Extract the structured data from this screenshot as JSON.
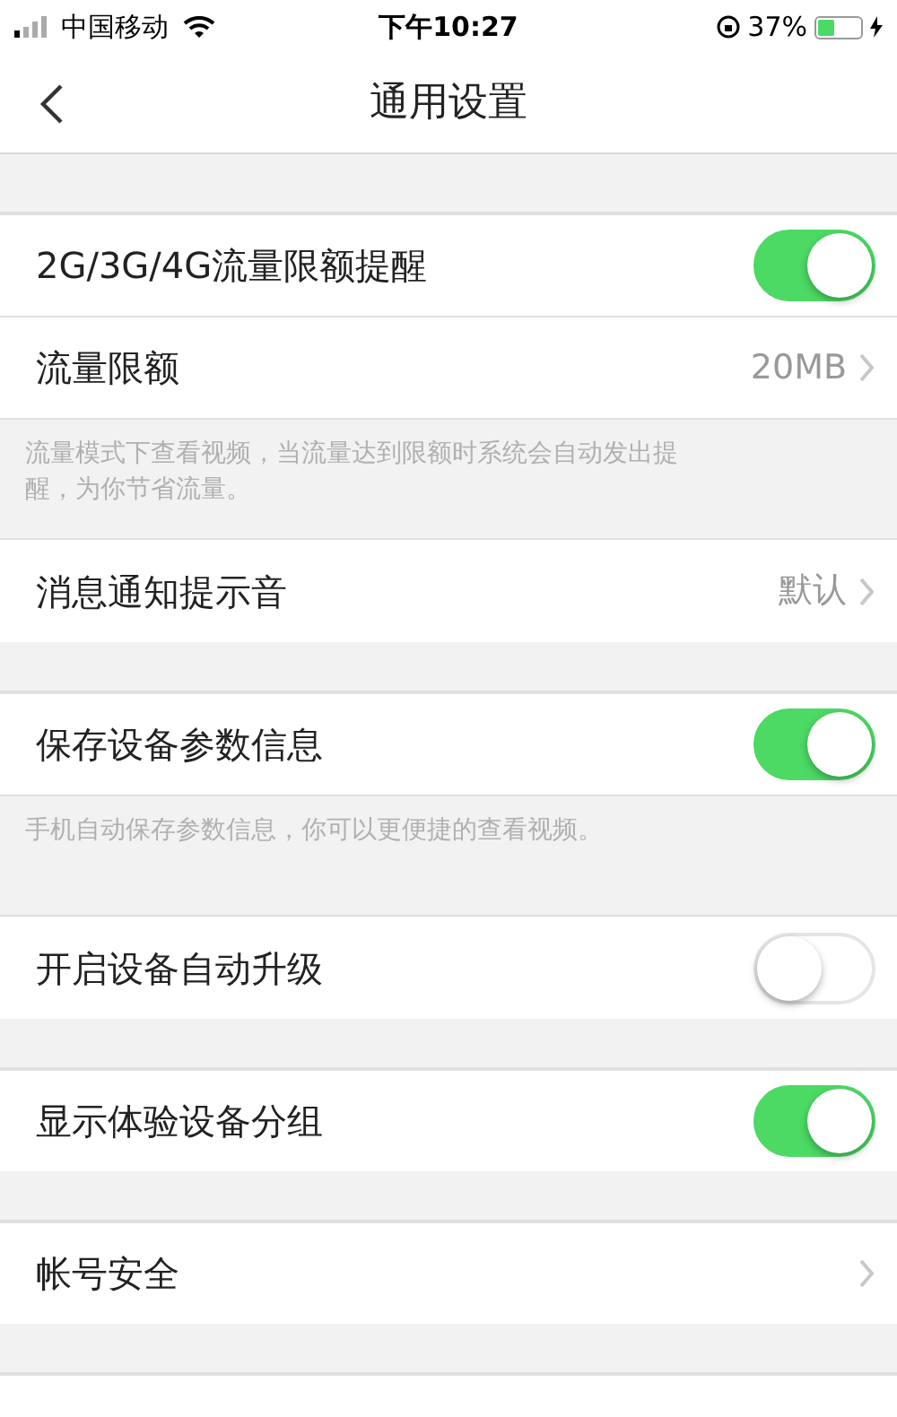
{
  "status_bar": {
    "carrier": "中国移动",
    "time": "下午10:27",
    "battery_percent": "37%",
    "charging": true
  },
  "nav": {
    "title": "通用设置"
  },
  "groups": [
    {
      "items": [
        {
          "kind": "toggle",
          "label": "2G/3G/4G流量限额提醒",
          "on": true
        },
        {
          "kind": "link",
          "label": "流量限额",
          "value": "20MB"
        }
      ],
      "note": "流量模式下查看视频，当流量达到限额时系统会自动发出提醒，为你节省流量。"
    },
    {
      "items": [
        {
          "kind": "link",
          "label": "消息通知提示音",
          "value": "默认"
        }
      ]
    },
    {
      "items": [
        {
          "kind": "toggle",
          "label": "保存设备参数信息",
          "on": true
        }
      ],
      "note": "手机自动保存参数信息，你可以更便捷的查看视频。"
    },
    {
      "items": [
        {
          "kind": "toggle",
          "label": "开启设备自动升级",
          "on": false
        }
      ]
    },
    {
      "items": [
        {
          "kind": "toggle",
          "label": "显示体验设备分组",
          "on": true
        }
      ]
    },
    {
      "items": [
        {
          "kind": "link",
          "label": "帐号安全"
        }
      ]
    },
    {
      "items": [
        {
          "kind": "blank"
        }
      ]
    }
  ]
}
